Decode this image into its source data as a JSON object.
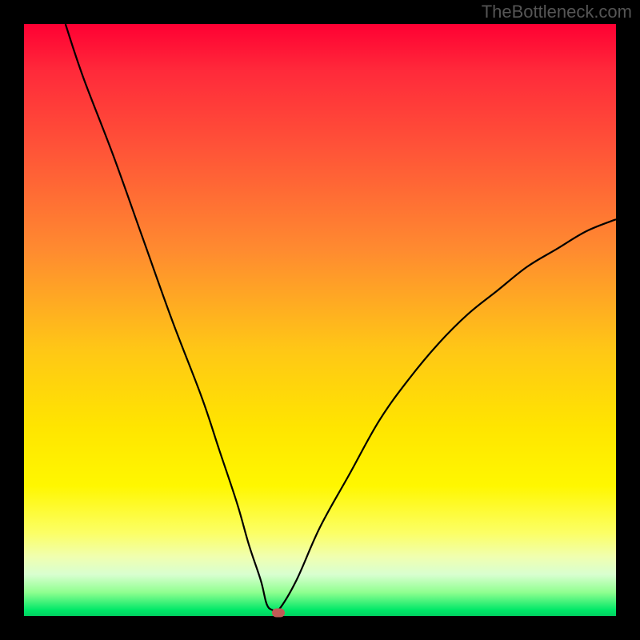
{
  "watermark": "TheBottleneck.com",
  "chart_data": {
    "type": "line",
    "title": "",
    "xlabel": "",
    "ylabel": "",
    "xlim": [
      0,
      100
    ],
    "ylim": [
      0,
      100
    ],
    "series": [
      {
        "name": "curve",
        "type": "line",
        "x": [
          7,
          10,
          15,
          20,
          25,
          30,
          33,
          36,
          38,
          40,
          41,
          42,
          43,
          46,
          50,
          55,
          60,
          65,
          70,
          75,
          80,
          85,
          90,
          95,
          100
        ],
        "y": [
          100,
          91,
          78,
          64,
          50,
          37,
          28,
          19,
          12,
          6,
          2,
          1,
          1,
          6,
          15,
          24,
          33,
          40,
          46,
          51,
          55,
          59,
          62,
          65,
          67
        ]
      }
    ],
    "marker": {
      "x": 43,
      "y": 0.5,
      "color": "#c25a56"
    },
    "background_gradient": {
      "type": "vertical",
      "stops": [
        {
          "pos": 0,
          "color": "#ff0033"
        },
        {
          "pos": 20,
          "color": "#ff5038"
        },
        {
          "pos": 55,
          "color": "#ffc716"
        },
        {
          "pos": 78,
          "color": "#fff700"
        },
        {
          "pos": 93,
          "color": "#d8ffd0"
        },
        {
          "pos": 100,
          "color": "#00d060"
        }
      ]
    }
  }
}
